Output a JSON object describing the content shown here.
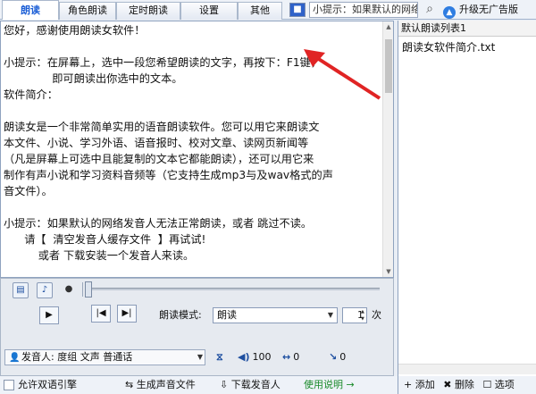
{
  "tabs": [
    "朗读",
    "角色朗读",
    "定时朗读",
    "设置",
    "其他"
  ],
  "active_tab": 0,
  "toolbar": {
    "palette_icon": "palette-icon",
    "tip_text": "小提示：如果默认的网络",
    "search_icon": "search-icon",
    "upgrade_label": "升级无广告版"
  },
  "text_lines": [
    "您好，感谢使用朗读女软件！",
    "",
    "小提示：在屏幕上，选中一段您希望朗读的文字，再按下：F1键，",
    "              即可朗读出你选中的文本。",
    "软件简介：",
    "",
    "朗读女是一个非常简单实用的语音朗读软件。您可以用它来朗读文",
    "本文件、小说、学习外语、语音报时、校对文章、读网页新闻等",
    "（凡是屏幕上可选中且能复制的文本它都能朗读），还可以用它来",
    "制作有声小说和学习资料音频等（它支持生成mp3与及wav格式的声",
    "音文件）。",
    "",
    "小提示：如果默认的网络发音人无法正常朗读，或者 跳过不读。",
    "      请【  清空发音人缓存文件  】再试试!",
    "          或者 下载安装一个发音人来读。"
  ],
  "list_panel": {
    "header": "默认朗读列表1",
    "items": [
      "朗读女软件简介.txt"
    ],
    "add_label": "添加",
    "delete_label": "删除",
    "select_label": "选项"
  },
  "controls": {
    "icons": [
      "document-icon",
      "music-note-icon",
      "microphone-icon"
    ],
    "play_icon": "play-icon",
    "prev_icon": "previous-icon",
    "next_icon": "next-icon",
    "mode_label": "朗读模式:",
    "mode_value": "朗读",
    "repeat_value": "1",
    "repeat_unit": "次",
    "slider_position": 0
  },
  "voice": {
    "prefix": "发音人:",
    "value": "度组 文声 普通话",
    "volume_label": "100",
    "speed_label": "0",
    "pitch_label": "0"
  },
  "bottom": {
    "checkbox_label": "允许双语引擎",
    "generate_label": "生成声音文件",
    "download_label": "下载发音人",
    "help_label": "使用说明 →"
  }
}
